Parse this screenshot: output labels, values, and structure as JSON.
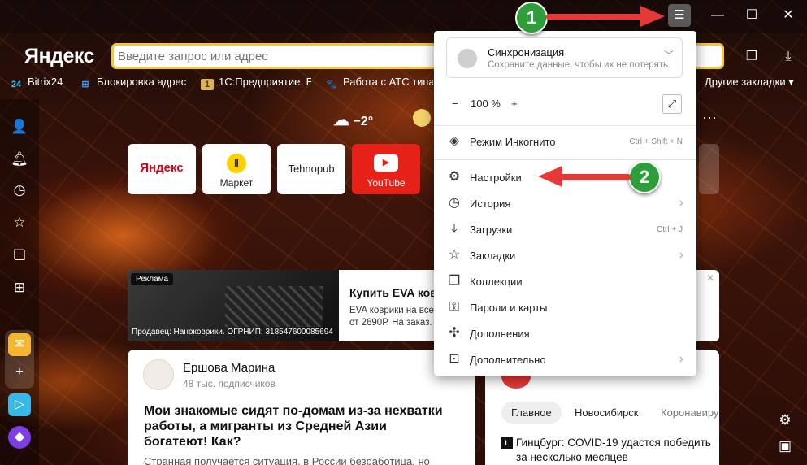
{
  "browser": {
    "logo": "Яндекс",
    "search_placeholder": "Введите запрос или адрес",
    "menu_icon": "hamburger-icon",
    "window_controls": [
      "minimize-icon",
      "maximize-icon",
      "close-icon"
    ],
    "toolbar_icons": [
      "collections-icon",
      "download-icon"
    ]
  },
  "bookmarks": {
    "items": [
      {
        "label": "Bitrix24",
        "icon": "24"
      },
      {
        "label": "Блокировка адрес",
        "icon": "windows"
      },
      {
        "label": "1С:Предприятие. Е",
        "icon": "1c"
      },
      {
        "label": "Работа с АТС типа",
        "icon": "dog"
      }
    ],
    "other": "Другие закладки"
  },
  "sidebar": {
    "icons": [
      "profile-icon",
      "bell-icon",
      "history-icon",
      "star-icon",
      "notes-icon",
      "apps-icon"
    ],
    "apps": [
      "mail-app",
      "add-app",
      "messenger-app",
      "alice-app"
    ]
  },
  "weather": {
    "temp": "−2°"
  },
  "tiles": [
    {
      "name": "yandex",
      "label": "Яндекс",
      "text": "Яндекс"
    },
    {
      "name": "market",
      "label": "Маркет"
    },
    {
      "name": "tehnopub",
      "label": "Tehnopub"
    },
    {
      "name": "youtube",
      "label": "YouTube"
    }
  ],
  "ad": {
    "tag": "Реклама",
    "sub": "Продавец: Наноковрики. ОГРНИП: 318547600085694",
    "title": "Купить EVA ковр",
    "text": "EVA коврики на все от 2690Р. На заказ."
  },
  "card": {
    "author": "Ершова Марина",
    "subs": "48 тыс. подписчиков",
    "title": "Мои знакомые сидят по-домам из-за нехватки работы, а мигранты из Средней Азии богатеют! Как?",
    "text": "Странная получается ситуация, в России безработица, но"
  },
  "news": {
    "tabs": [
      "Главное",
      "Новосибирск",
      "Коронавиру"
    ],
    "item_source": "L",
    "item_text": "Гинцбург: COVID-19 удастся победить за несколько месяцев"
  },
  "menu": {
    "sync_title": "Синхронизация",
    "sync_sub": "Сохраните данные, чтобы их не потерять",
    "zoom_minus": "−",
    "zoom_value": "100 %",
    "zoom_plus": "+",
    "items": [
      {
        "label": "Режим Инкогнито",
        "shortcut": "Ctrl + Shift + N",
        "icon": "incognito-icon"
      },
      {
        "label": "Настройки",
        "shortcut": "",
        "icon": "gear-icon"
      },
      {
        "label": "История",
        "shortcut": "",
        "icon": "history-icon",
        "submenu": true
      },
      {
        "label": "Загрузки",
        "shortcut": "Ctrl + J",
        "icon": "download-icon"
      },
      {
        "label": "Закладки",
        "shortcut": "",
        "icon": "bookmark-star-icon",
        "submenu": true
      },
      {
        "label": "Коллекции",
        "shortcut": "",
        "icon": "collections-icon"
      },
      {
        "label": "Пароли и карты",
        "shortcut": "",
        "icon": "key-icon"
      },
      {
        "label": "Дополнения",
        "shortcut": "",
        "icon": "puzzle-icon"
      },
      {
        "label": "Дополнительно",
        "shortcut": "",
        "icon": "more-icon",
        "submenu": true
      }
    ]
  },
  "annotations": {
    "step1": "1",
    "step2": "2",
    "accent": "#e53935",
    "badge_color": "#2e9e3a"
  }
}
